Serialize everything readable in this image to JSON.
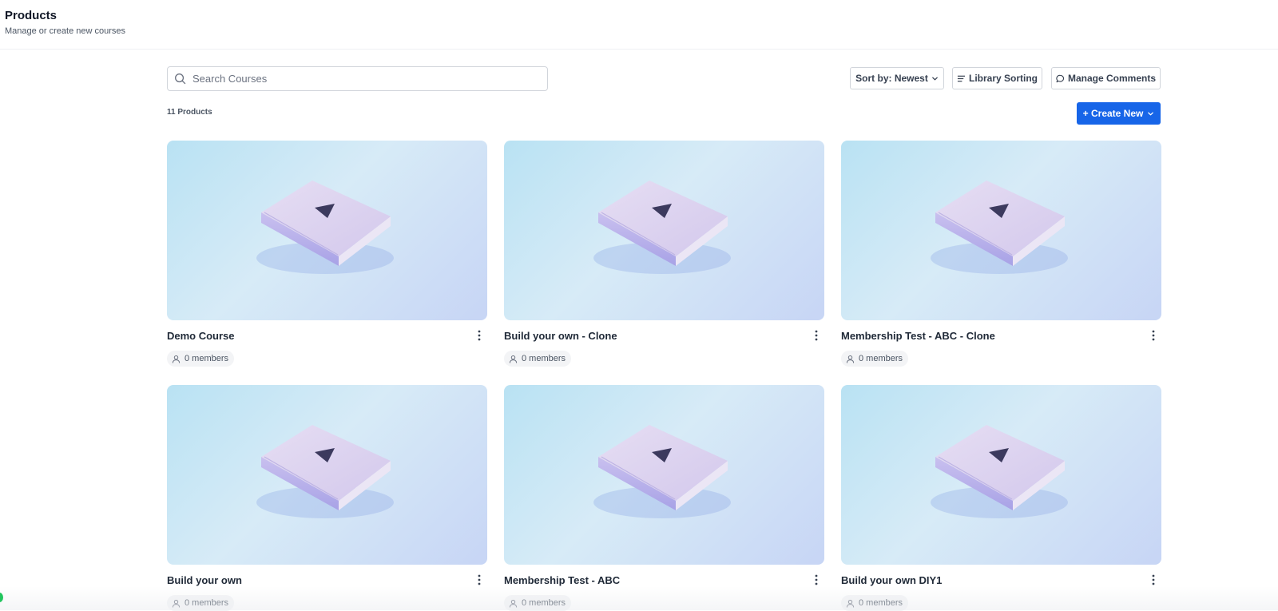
{
  "header": {
    "title": "Products",
    "subtitle": "Manage or create new courses"
  },
  "toolbar": {
    "search_placeholder": "Search Courses",
    "sort_label": "Sort by: Newest",
    "library_sorting_label": "Library Sorting",
    "manage_comments_label": "Manage Comments",
    "product_count": "11 Products",
    "create_new_label": "+ Create New"
  },
  "courses": [
    {
      "title": "Demo Course",
      "members": "0 members"
    },
    {
      "title": "Build your own - Clone",
      "members": "0 members"
    },
    {
      "title": "Membership Test - ABC - Clone",
      "members": "0 members"
    },
    {
      "title": "Build your own",
      "members": "0 members"
    },
    {
      "title": "Membership Test - ABC",
      "members": "0 members"
    },
    {
      "title": "Build your own DIY1",
      "members": "0 members"
    }
  ],
  "colors": {
    "accent": "#1765e8",
    "thumbnail_gradient_start": "#b9e2f3",
    "thumbnail_gradient_end": "#c7d5f5"
  },
  "icons": {
    "search": "search-icon",
    "sort": "chevron-down-icon",
    "library": "list-icon",
    "comments": "comment-icon",
    "card_menu": "kebab-menu-icon",
    "members": "user-icon",
    "thumbnail": "book-play-icon"
  }
}
